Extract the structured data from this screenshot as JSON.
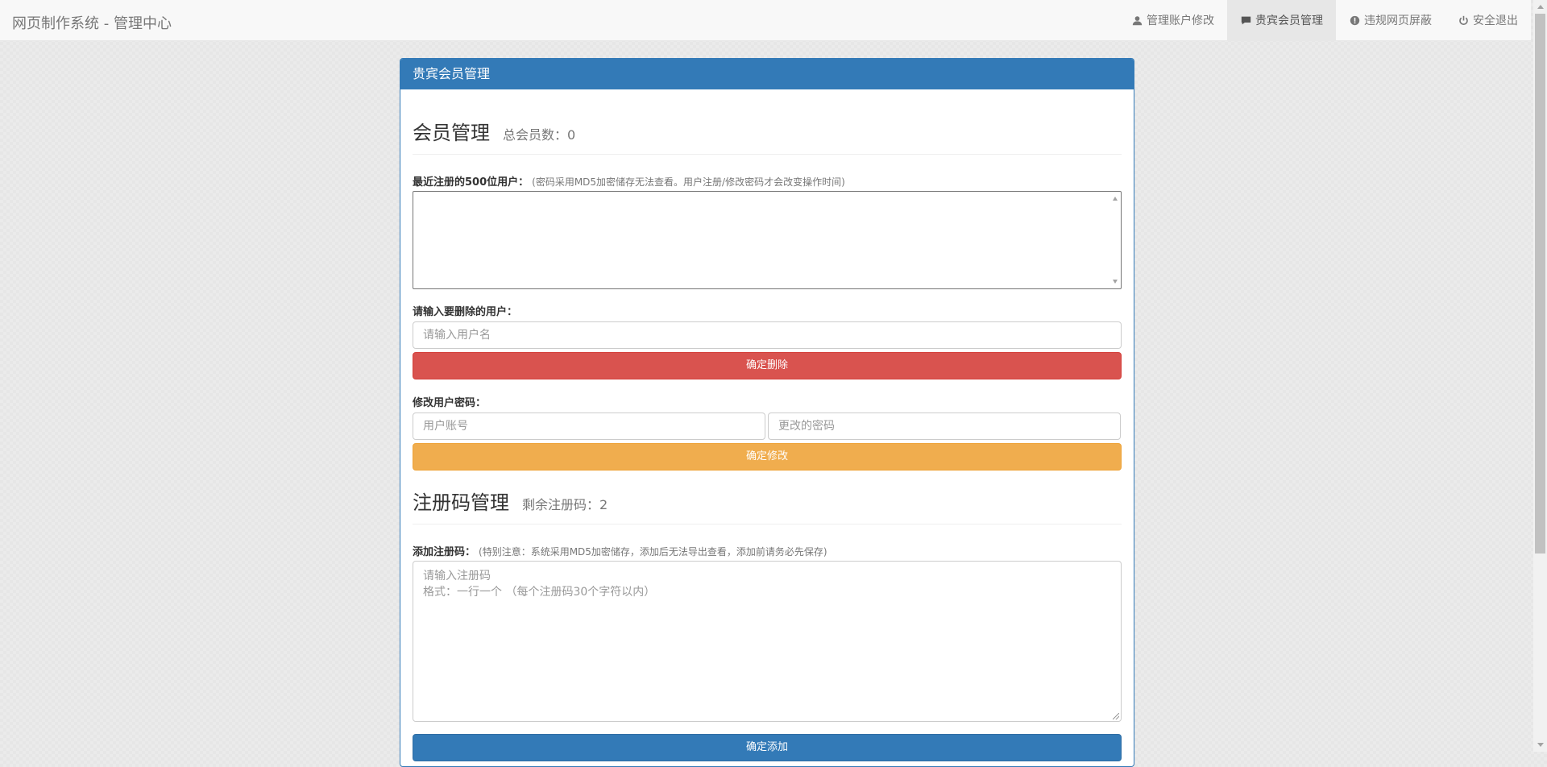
{
  "navbar": {
    "brand": "网页制作系统 - 管理中心",
    "items": [
      {
        "label": "管理账户修改",
        "icon": "user-icon",
        "active": false
      },
      {
        "label": "贵宾会员管理",
        "icon": "comment-icon",
        "active": true
      },
      {
        "label": "违规网页屏蔽",
        "icon": "exclamation-sign-icon",
        "active": false
      },
      {
        "label": "安全退出",
        "icon": "power-icon",
        "active": false
      }
    ]
  },
  "panel": {
    "heading": "贵宾会员管理",
    "members": {
      "title": "会员管理",
      "count_text": "总会员数：0",
      "recent_label": "最近注册的500位用户：",
      "recent_hint": "(密码采用MD5加密储存无法查看。用户注册/修改密码才会改变操作时间)",
      "recent_value": ""
    },
    "delete": {
      "label": "请输入要删除的用户：",
      "placeholder": "请输入用户名",
      "button": "确定删除"
    },
    "change_password": {
      "label": "修改用户密码：",
      "account_placeholder": "用户账号",
      "password_placeholder": "更改的密码",
      "button": "确定修改"
    },
    "codes": {
      "title": "注册码管理",
      "remaining_text": "剩余注册码：2",
      "add_label": "添加注册码：",
      "add_hint": "(特别注意：系统采用MD5加密储存，添加后无法导出查看，添加前请务必先保存)",
      "placeholder": "请输入注册码\n格式：一行一个 （每个注册码30个字符以内）",
      "button": "确定添加"
    }
  },
  "colors": {
    "primary": "#337ab7",
    "danger": "#d9534f",
    "warning": "#f0ad4e"
  }
}
